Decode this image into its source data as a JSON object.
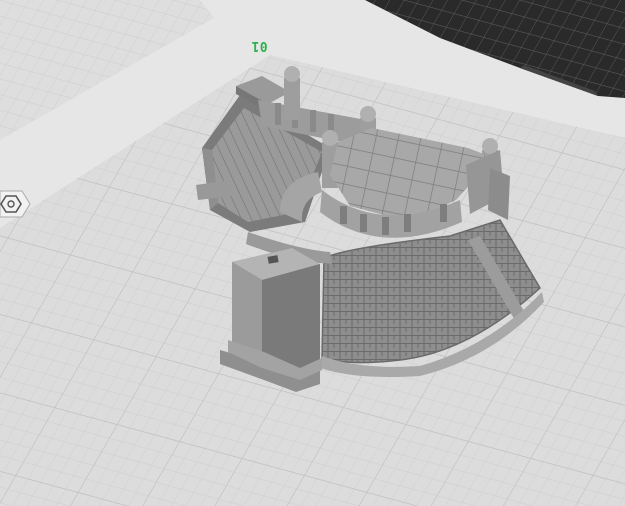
{
  "plate": {
    "label": "01"
  },
  "icons": {
    "left_edge": "hexagon-nut-icon"
  },
  "colors": {
    "background": "#e6e6e6",
    "grid_line": "#c9c9c9",
    "plate_fill": "#dcdcdc",
    "dark_plate": "#2a2a2a",
    "label_green": "#2bb24c",
    "model_light": "#a7a7a7",
    "model_mid": "#8c8c8c",
    "model_dark": "#6a6a6a"
  }
}
